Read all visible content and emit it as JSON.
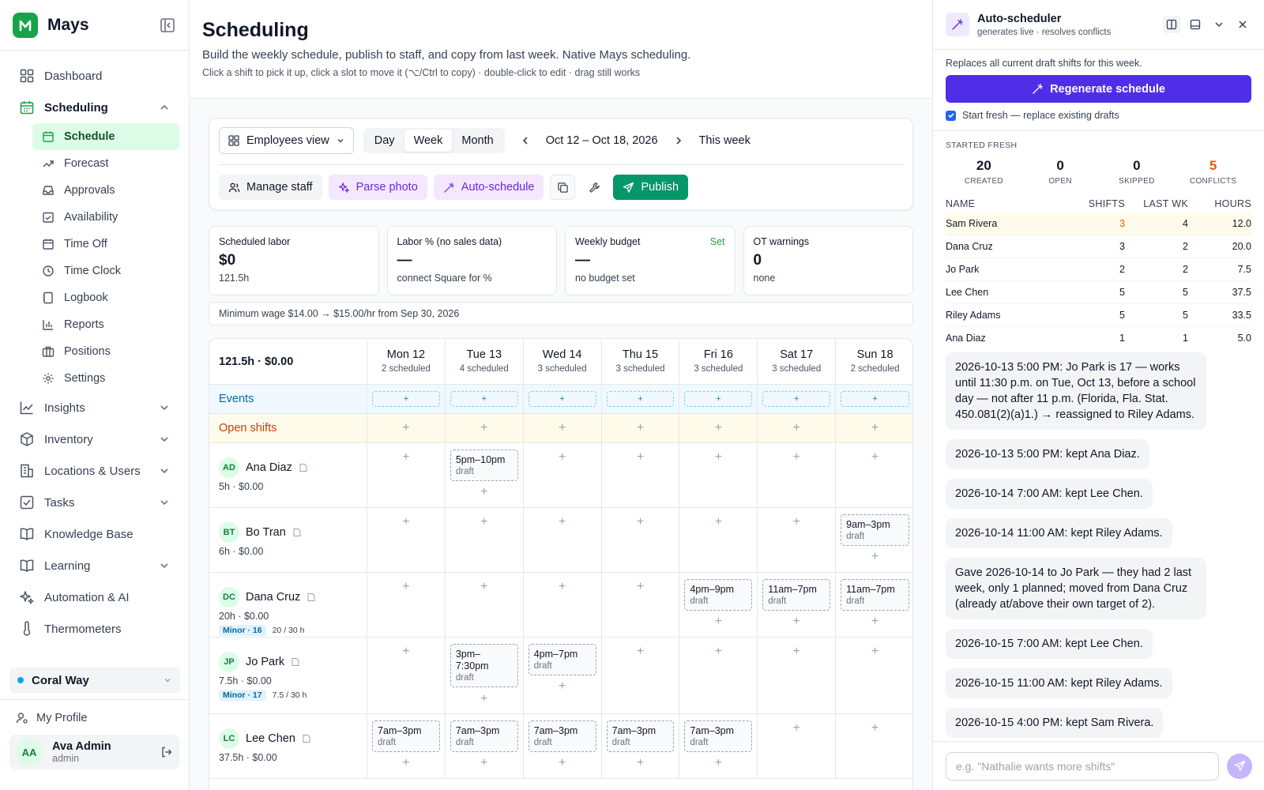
{
  "app": {
    "name": "Mays"
  },
  "sidebar": {
    "items": [
      {
        "label": "Dashboard",
        "icon": "dashboard-icon"
      },
      {
        "label": "Scheduling",
        "icon": "calendar-icon",
        "open": true
      },
      {
        "label": "Insights",
        "icon": "chart-line-icon"
      },
      {
        "label": "Inventory",
        "icon": "box-icon"
      },
      {
        "label": "Locations & Users",
        "icon": "building-icon"
      },
      {
        "label": "Tasks",
        "icon": "checkbox-icon"
      },
      {
        "label": "Knowledge Base",
        "icon": "book-icon"
      },
      {
        "label": "Learning",
        "icon": "book-open-icon"
      },
      {
        "label": "Automation & AI",
        "icon": "sparkles-icon"
      },
      {
        "label": "Thermometers",
        "icon": "thermometer-icon"
      }
    ],
    "scheduling_sub": [
      {
        "label": "Schedule",
        "icon": "calendar-icon"
      },
      {
        "label": "Forecast",
        "icon": "trend-up-icon"
      },
      {
        "label": "Approvals",
        "icon": "inbox-icon"
      },
      {
        "label": "Availability",
        "icon": "calendar-check-icon"
      },
      {
        "label": "Time Off",
        "icon": "calendar-icon"
      },
      {
        "label": "Time Clock",
        "icon": "clock-icon"
      },
      {
        "label": "Logbook",
        "icon": "notebook-icon"
      },
      {
        "label": "Reports",
        "icon": "bar-chart-icon"
      },
      {
        "label": "Positions",
        "icon": "briefcase-icon"
      },
      {
        "label": "Settings",
        "icon": "gear-icon"
      }
    ],
    "location": "Coral Way",
    "profile_link": "My Profile",
    "user": {
      "initials": "AA",
      "name": "Ava Admin",
      "role": "admin"
    }
  },
  "page": {
    "title": "Scheduling",
    "subtitle": "Build the weekly schedule, publish to staff, and copy from last week. Native Mays scheduling.",
    "hint": "Click a shift to pick it up, click a slot to move it (⌥/Ctrl to copy) · double-click to edit · drag still works"
  },
  "toolbar": {
    "view_select": "Employees view",
    "segments": [
      "Day",
      "Week",
      "Month"
    ],
    "active_segment": "Week",
    "range": "Oct 12 – Oct 18, 2026",
    "this_week": "This week",
    "manage_staff": "Manage staff",
    "parse_photo": "Parse photo",
    "auto_schedule": "Auto-schedule",
    "publish": "Publish"
  },
  "stats": [
    {
      "label": "Scheduled labor",
      "value": "$0",
      "sub": "121.5h"
    },
    {
      "label": "Labor % (no sales data)",
      "value": "—",
      "sub": "connect Square for %"
    },
    {
      "label": "Weekly budget",
      "value": "—",
      "sub": "no budget set",
      "link": "Set"
    },
    {
      "label": "OT warnings",
      "value": "0",
      "sub": "none"
    }
  ],
  "notice": "Minimum wage $14.00 → $15.00/hr from Sep 30, 2026",
  "grid": {
    "summary": "121.5h · $0.00",
    "days": [
      {
        "name": "Mon 12",
        "count": "2 scheduled"
      },
      {
        "name": "Tue 13",
        "count": "4 scheduled"
      },
      {
        "name": "Wed 14",
        "count": "3 scheduled"
      },
      {
        "name": "Thu 15",
        "count": "3 scheduled"
      },
      {
        "name": "Fri 16",
        "count": "3 scheduled"
      },
      {
        "name": "Sat 17",
        "count": "3 scheduled"
      },
      {
        "name": "Sun 18",
        "count": "2 scheduled"
      }
    ],
    "events_label": "Events",
    "events_add": "+",
    "open_label": "Open shifts",
    "employees": [
      {
        "initials": "AD",
        "name": "Ana Diaz",
        "meta": "5h · $0.00",
        "minor": "",
        "hours": "",
        "shifts": [
          null,
          {
            "time": "5pm–10pm",
            "status": "draft"
          },
          null,
          null,
          null,
          null,
          null
        ]
      },
      {
        "initials": "BT",
        "name": "Bo Tran",
        "meta": "6h · $0.00",
        "minor": "",
        "hours": "",
        "shifts": [
          null,
          null,
          null,
          null,
          null,
          null,
          {
            "time": "9am–3pm",
            "status": "draft"
          }
        ]
      },
      {
        "initials": "DC",
        "name": "Dana Cruz",
        "meta": "20h · $0.00",
        "minor": "Minor · 16",
        "hours": "20 / 30 h",
        "shifts": [
          null,
          null,
          null,
          null,
          {
            "time": "4pm–9pm",
            "status": "draft"
          },
          {
            "time": "11am–7pm",
            "status": "draft"
          },
          {
            "time": "11am–7pm",
            "status": "draft"
          }
        ]
      },
      {
        "initials": "JP",
        "name": "Jo Park",
        "meta": "7.5h · $0.00",
        "minor": "Minor · 17",
        "hours": "7.5 / 30 h",
        "shifts": [
          null,
          {
            "time": "3pm–7:30pm",
            "status": "draft"
          },
          {
            "time": "4pm–7pm",
            "status": "draft"
          },
          null,
          null,
          null,
          null
        ]
      },
      {
        "initials": "LC",
        "name": "Lee Chen",
        "meta": "37.5h · $0.00",
        "minor": "",
        "hours": "",
        "shifts": [
          {
            "time": "7am–3pm",
            "status": "draft"
          },
          {
            "time": "7am–3pm",
            "status": "draft"
          },
          {
            "time": "7am–3pm",
            "status": "draft"
          },
          {
            "time": "7am–3pm",
            "status": "draft"
          },
          {
            "time": "7am–3pm",
            "status": "draft"
          },
          null,
          null
        ]
      }
    ]
  },
  "panel": {
    "title": "Auto-scheduler",
    "subtitle": "generates live · resolves conflicts",
    "replace_note": "Replaces all current draft shifts for this week.",
    "regenerate": "Regenerate schedule",
    "fresh_label": "Start fresh — replace existing drafts",
    "fresh_checked": true,
    "started": "STARTED FRESH",
    "stats": [
      {
        "value": "20",
        "label": "CREATED"
      },
      {
        "value": "0",
        "label": "OPEN"
      },
      {
        "value": "0",
        "label": "SKIPPED"
      },
      {
        "value": "5",
        "label": "CONFLICTS",
        "warn": true
      }
    ],
    "table_head": {
      "name": "NAME",
      "shifts": "SHIFTS",
      "last": "LAST WK",
      "hours": "HOURS"
    },
    "table": [
      {
        "name": "Sam Rivera",
        "shifts": "3",
        "last": "4",
        "hours": "12.0",
        "highlight": true
      },
      {
        "name": "Dana Cruz",
        "shifts": "3",
        "last": "2",
        "hours": "20.0"
      },
      {
        "name": "Jo Park",
        "shifts": "2",
        "last": "2",
        "hours": "7.5"
      },
      {
        "name": "Lee Chen",
        "shifts": "5",
        "last": "5",
        "hours": "37.5"
      },
      {
        "name": "Riley Adams",
        "shifts": "5",
        "last": "5",
        "hours": "33.5"
      },
      {
        "name": "Ana Diaz",
        "shifts": "1",
        "last": "1",
        "hours": "5.0"
      }
    ],
    "log": [
      "2026-10-13 5:00 PM: Jo Park is 17 — works until 11:30 p.m. on Tue, Oct 13, before a school day — not after 11 p.m. (Florida, Fla. Stat. 450.081(2)(a)1.) → reassigned to Riley Adams.",
      "2026-10-13 5:00 PM: kept Ana Diaz.",
      "2026-10-14 7:00 AM: kept Lee Chen.",
      "2026-10-14 11:00 AM: kept Riley Adams.",
      "Gave 2026-10-14 to Jo Park — they had 2 last week, only 1 planned; moved from Dana Cruz (already at/above their own target of 2).",
      "2026-10-15 7:00 AM: kept Lee Chen.",
      "2026-10-15 11:00 AM: kept Riley Adams.",
      "2026-10-15 4:00 PM: kept Sam Rivera."
    ],
    "input_placeholder": "e.g. \"Nathalie wants more shifts\""
  }
}
